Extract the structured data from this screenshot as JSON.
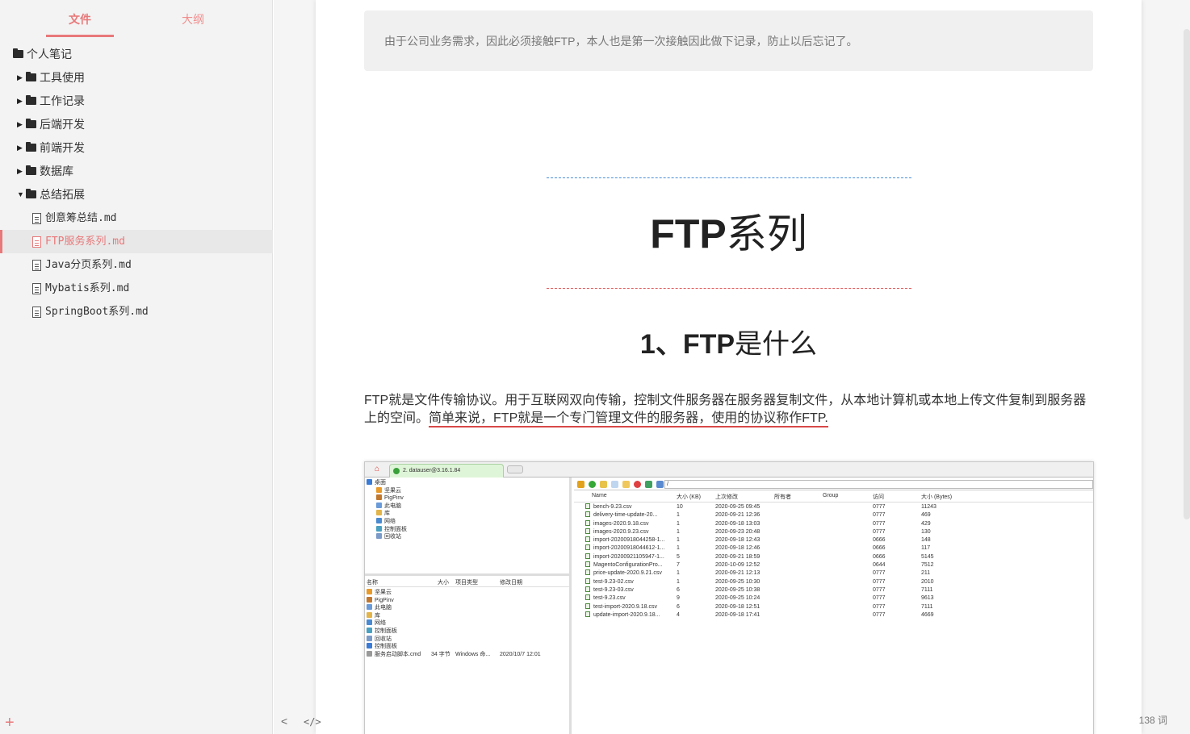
{
  "sidebar": {
    "tabs": [
      {
        "label": "文件"
      },
      {
        "label": "大纲"
      }
    ],
    "tree": [
      {
        "label": "个人笔记",
        "type": "folder",
        "level": 0
      },
      {
        "label": "工具使用",
        "type": "folder",
        "level": 1
      },
      {
        "label": "工作记录",
        "type": "folder",
        "level": 1
      },
      {
        "label": "后端开发",
        "type": "folder",
        "level": 1
      },
      {
        "label": "前端开发",
        "type": "folder",
        "level": 1
      },
      {
        "label": "数据库",
        "type": "folder",
        "level": 1
      },
      {
        "label": "总结拓展",
        "type": "folder",
        "level": 1,
        "expanded": true
      },
      {
        "label": "创意筹总结.md",
        "type": "file",
        "level": 2
      },
      {
        "label": "FTP服务系列.md",
        "type": "file",
        "level": 2,
        "active": true
      },
      {
        "label": "Java分页系列.md",
        "type": "file",
        "level": 2
      },
      {
        "label": "Mybatis系列.md",
        "type": "file",
        "level": 2
      },
      {
        "label": "SpringBoot系列.md",
        "type": "file",
        "level": 2
      }
    ],
    "add_icon": "+"
  },
  "doc": {
    "quote": "由于公司业务需求，因此必须接触FTP，本人也是第一次接触因此做下记录，防止以后忘记了。",
    "h1_latin": "FTP",
    "h1_cn": "系列",
    "h2_num": "1、",
    "h2_latin": "FTP",
    "h2_cn": "是什么",
    "para_plain": "FTP就是文件传输协议。用于互联网双向传输，控制文件服务器在服务器复制文件，从本地计算机或本地上传文件复制到服务器上的空间。",
    "para_underline": "简单来说，FTP就是一个专门管理文件的服务器，使用的协议称作FTP."
  },
  "screenshot": {
    "tab_label": "2. datauser@3.16.1.84",
    "path": "/",
    "tree": [
      "桌面",
      "坚果云",
      "PigPinv",
      "此电脑",
      "库",
      "网络",
      "控制面板",
      "回收站"
    ],
    "list_headers": [
      "名称",
      "大小",
      "项目类型",
      "修改日期"
    ],
    "list": [
      "坚果云",
      "PigPinv",
      "此电脑",
      "库",
      "网络",
      "控制面板",
      "回收站",
      "控制面板"
    ],
    "list_last": {
      "name": "服务启动脚本.cmd",
      "size": "34 字节",
      "type": "Windows 命...",
      "date": "2020/10/7 12:01"
    },
    "file_headers": [
      "Name",
      "大小 (KB)",
      "上次修改",
      "所有者",
      "Group",
      "访问",
      "大小 (Bytes)"
    ],
    "files": [
      {
        "name": "bench-9.23.csv",
        "size": "10",
        "mod": "2020-09-25 09:45",
        "perm": "0777",
        "bytes": "11243"
      },
      {
        "name": "delivery-time-update-20...",
        "size": "1",
        "mod": "2020-09-21 12:36",
        "perm": "0777",
        "bytes": "469"
      },
      {
        "name": "images-2020.9.18.csv",
        "size": "1",
        "mod": "2020-09-18 13:03",
        "perm": "0777",
        "bytes": "429"
      },
      {
        "name": "images-2020.9.23.csv",
        "size": "1",
        "mod": "2020-09-23 20:48",
        "perm": "0777",
        "bytes": "130"
      },
      {
        "name": "import-20200918044258-1...",
        "size": "1",
        "mod": "2020-09-18 12:43",
        "perm": "0666",
        "bytes": "148"
      },
      {
        "name": "import-20200918044612-1...",
        "size": "1",
        "mod": "2020-09-18 12:46",
        "perm": "0666",
        "bytes": "117"
      },
      {
        "name": "import-20200921105947-1...",
        "size": "5",
        "mod": "2020-09-21 18:59",
        "perm": "0666",
        "bytes": "5145"
      },
      {
        "name": "MagentoConfigurationPro...",
        "size": "7",
        "mod": "2020-10-09 12:52",
        "perm": "0644",
        "bytes": "7512"
      },
      {
        "name": "price-update-2020.9.21.csv",
        "size": "1",
        "mod": "2020-09-21 12:13",
        "perm": "0777",
        "bytes": "211"
      },
      {
        "name": "test-9.23-02.csv",
        "size": "1",
        "mod": "2020-09-25 10:30",
        "perm": "0777",
        "bytes": "2010"
      },
      {
        "name": "test-9.23-03.csv",
        "size": "6",
        "mod": "2020-09-25 10:38",
        "perm": "0777",
        "bytes": "7111"
      },
      {
        "name": "test-9.23.csv",
        "size": "9",
        "mod": "2020-09-25 10:24",
        "perm": "0777",
        "bytes": "9613"
      },
      {
        "name": "test-import-2020.9.18.csv",
        "size": "6",
        "mod": "2020-09-18 12:51",
        "perm": "0777",
        "bytes": "7111"
      },
      {
        "name": "update-import-2020.9.18...",
        "size": "4",
        "mod": "2020-09-18 17:41",
        "perm": "0777",
        "bytes": "4669"
      }
    ]
  },
  "statusbar": {
    "left_icon": "<",
    "source_icon": "</>",
    "word_count": "138 词"
  },
  "colors": {
    "accent": "#e8787a",
    "underline": "#d94848"
  },
  "icons": [
    "folder-icon",
    "file-icon",
    "expand-arrow-icon",
    "add-icon",
    "chevron-left-icon",
    "source-code-icon"
  ]
}
